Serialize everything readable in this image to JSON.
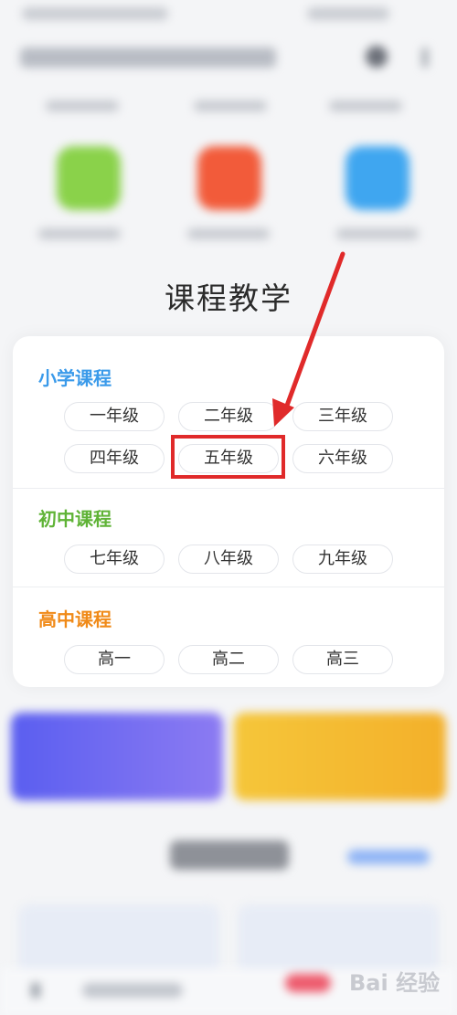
{
  "section_title": "课程教学",
  "categories": [
    {
      "name": "小学课程",
      "color": "#3a9aea",
      "grades": [
        "一年级",
        "二年级",
        "三年级",
        "四年级",
        "五年级",
        "六年级"
      ]
    },
    {
      "name": "初中课程",
      "color": "#5fb336",
      "grades": [
        "七年级",
        "八年级",
        "九年级"
      ]
    },
    {
      "name": "高中课程",
      "color": "#f08a18",
      "grades": [
        "高一",
        "高二",
        "高三"
      ]
    }
  ],
  "highlighted_grade": "五年级",
  "annotation_color": "#e02a2a",
  "watermark": "Bai 经验",
  "quick_icons": [
    {
      "name": "green-book-icon",
      "color": "#8ad24a"
    },
    {
      "name": "red-gift-icon",
      "color": "#f25b3a"
    },
    {
      "name": "blue-cloud-icon",
      "color": "#3fa6f0"
    }
  ]
}
